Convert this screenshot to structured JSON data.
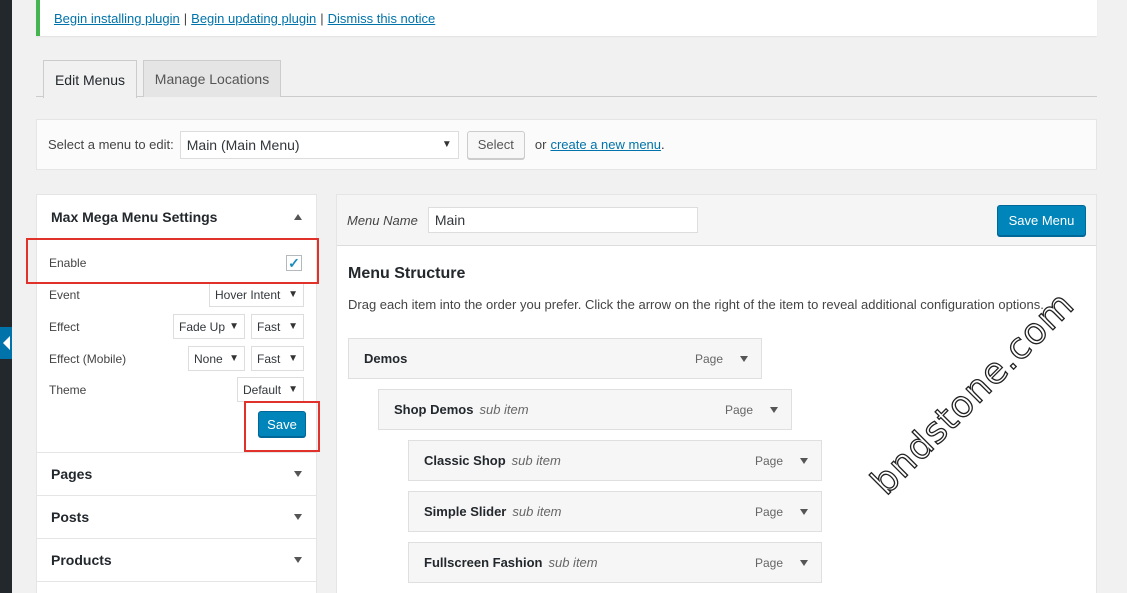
{
  "notice": {
    "links": [
      "Begin installing plugin",
      "Begin updating plugin",
      "Dismiss this notice"
    ],
    "separator": "|"
  },
  "tabs": [
    {
      "label": "Edit Menus",
      "active": true
    },
    {
      "label": "Manage Locations",
      "active": false
    }
  ],
  "select_menu": {
    "label": "Select a menu to edit:",
    "selected": "Main (Main Menu)",
    "button": "Select",
    "or": "or",
    "create_link": "create a new menu",
    "period": "."
  },
  "mega_menu": {
    "title": "Max Mega Menu Settings",
    "enable_label": "Enable",
    "enabled": true,
    "event_label": "Event",
    "event_value": "Hover Intent",
    "effect_label": "Effect",
    "effect_value": "Fade Up",
    "effect_speed": "Fast",
    "effect_mobile_label": "Effect (Mobile)",
    "effect_mobile_value": "None",
    "effect_mobile_speed": "Fast",
    "theme_label": "Theme",
    "theme_value": "Default",
    "save": "Save"
  },
  "accordions": [
    "Pages",
    "Posts",
    "Products"
  ],
  "menu_editor": {
    "name_label": "Menu Name",
    "name_value": "Main",
    "save_button": "Save Menu",
    "structure_title": "Menu Structure",
    "structure_desc": "Drag each item into the order you prefer. Click the arrow on the right of the item to reveal additional configuration options.",
    "items": [
      {
        "title": "Demos",
        "sub": "",
        "type": "Page",
        "depth": 0
      },
      {
        "title": "Shop Demos",
        "sub": "sub item",
        "type": "Page",
        "depth": 1
      },
      {
        "title": "Classic Shop",
        "sub": "sub item",
        "type": "Page",
        "depth": 2
      },
      {
        "title": "Simple Slider",
        "sub": "sub item",
        "type": "Page",
        "depth": 2
      },
      {
        "title": "Fullscreen Fashion",
        "sub": "sub item",
        "type": "Page",
        "depth": 2
      }
    ]
  },
  "colors": {
    "primary": "#0085ba",
    "link": "#0073aa",
    "highlight": "#e0312a"
  },
  "watermark": "bndstone.com"
}
